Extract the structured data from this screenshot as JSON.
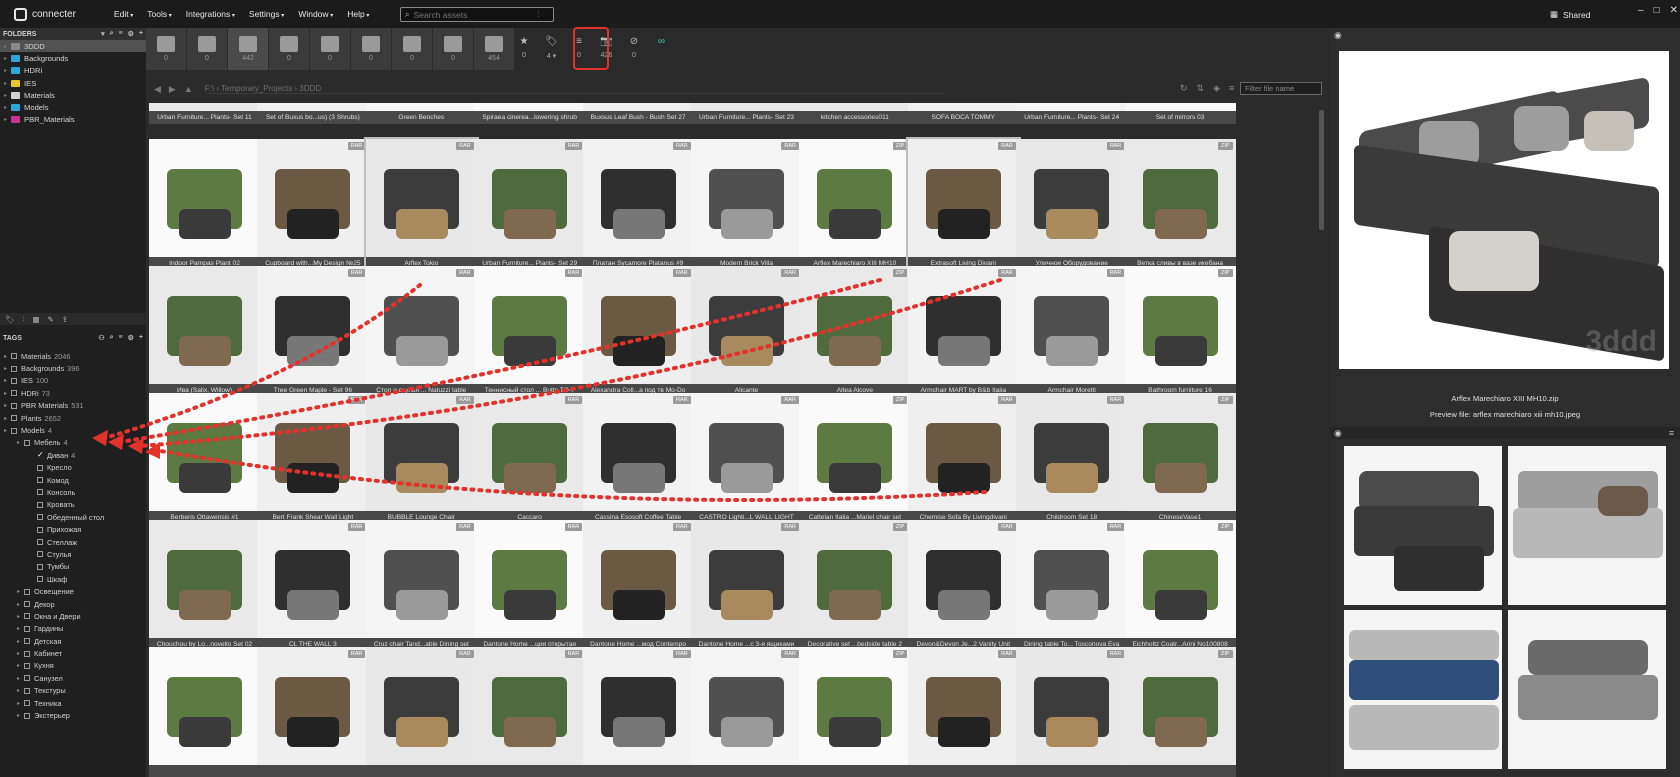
{
  "app": {
    "name": "connecter",
    "shared_label": "Shared"
  },
  "menu": [
    "Edit",
    "Tools",
    "Integrations",
    "Settings",
    "Window",
    "Help"
  ],
  "search": {
    "placeholder": "Search assets"
  },
  "folders_header": "FOLDERS",
  "folders": [
    {
      "label": "3DDD",
      "color": "#8a8a8a",
      "selected": true
    },
    {
      "label": "Backgrounds",
      "color": "#2fa6d8"
    },
    {
      "label": "HDRi",
      "color": "#2fa6d8"
    },
    {
      "label": "IES",
      "color": "#e7c52b"
    },
    {
      "label": "Materials",
      "color": "#d0d0d0"
    },
    {
      "label": "Models",
      "color": "#2fa6d8"
    },
    {
      "label": "PBR_Materials",
      "color": "#c8338e"
    }
  ],
  "tags_header": "TAGS",
  "tags": [
    {
      "label": "Materials",
      "count": "2046"
    },
    {
      "label": "Backgrounds",
      "count": "396"
    },
    {
      "label": "IES",
      "count": "100"
    },
    {
      "label": "HDRi",
      "count": "73"
    },
    {
      "label": "PBR Materials",
      "count": "531"
    },
    {
      "label": "Plants",
      "count": "2652"
    },
    {
      "label": "Models",
      "count": "4"
    },
    {
      "label": "Мебель",
      "count": "4",
      "level": 1
    },
    {
      "label": "Диван",
      "count": "4",
      "level": 2,
      "checked": true
    },
    {
      "label": "Кресло",
      "level": 2
    },
    {
      "label": "Комод",
      "level": 2
    },
    {
      "label": "Консоль",
      "level": 2
    },
    {
      "label": "Кровать",
      "level": 2
    },
    {
      "label": "Обеденный стол",
      "level": 2
    },
    {
      "label": "Прихожая",
      "level": 2
    },
    {
      "label": "Стеллаж",
      "level": 2
    },
    {
      "label": "Стулья",
      "level": 2
    },
    {
      "label": "Тумбы",
      "level": 2
    },
    {
      "label": "Шкаф",
      "level": 2
    },
    {
      "label": "Освещение",
      "level": 1
    },
    {
      "label": "Декор",
      "level": 1
    },
    {
      "label": "Окна и Двери",
      "level": 1
    },
    {
      "label": "Гардины",
      "level": 1
    },
    {
      "label": "Детская",
      "level": 1
    },
    {
      "label": "Кабинет",
      "level": 1
    },
    {
      "label": "Кухня",
      "level": 1
    },
    {
      "label": "Санузел",
      "level": 1
    },
    {
      "label": "Текстуры",
      "level": 1
    },
    {
      "label": "Техника",
      "level": 1
    },
    {
      "label": "Экстерьер",
      "level": 1
    }
  ],
  "toolbar_types": [
    {
      "icon": "cube-icon",
      "count": "0"
    },
    {
      "icon": "sphere-icon",
      "count": "0"
    },
    {
      "icon": "image-icon",
      "count": "442"
    },
    {
      "icon": "video-icon",
      "count": "0"
    },
    {
      "icon": "audio-icon",
      "count": "0"
    },
    {
      "icon": "building-icon",
      "count": "0"
    },
    {
      "icon": "vector-icon",
      "count": "0"
    },
    {
      "icon": "code-icon",
      "count": "0"
    },
    {
      "icon": "document-icon",
      "count": "454"
    }
  ],
  "toolbar_filters": [
    {
      "icon": "star-icon",
      "glyph": "★",
      "count": "0"
    },
    {
      "icon": "tag-icon",
      "glyph": "🏷",
      "count": "4 ▾"
    },
    {
      "icon": "list-icon",
      "glyph": "≡",
      "count": "0"
    },
    {
      "icon": "camera-icon",
      "glyph": "📷",
      "count": "426"
    },
    {
      "icon": "no-preview-icon",
      "glyph": "⊘",
      "count": "0"
    },
    {
      "icon": "link-icon",
      "glyph": "∞",
      "count": ""
    }
  ],
  "path": "F:\\ › Temporary_Projects › 3DDD",
  "filter_placeholder": "Filter file name",
  "grid_rows": [
    [
      "Urban Furniture... Plants- Set 11",
      "Set of Buxus bo...us) (3 Shrubs)",
      "Green Benches",
      "Spiraea cinerea...lowering shrub",
      "Buxsus Leaf Bush - Bush Set 27",
      "Urban Furniture... Plants- Set 23",
      "kitchen accessories011",
      "SOFA BOCA TOMMY",
      "Urban Furniture... Plants- Set 24",
      "Set of mirrors 03"
    ],
    [
      "Indoor Pampas Plant 02",
      "Cupboard with...My Design №25",
      "Arflex Tokio",
      "Urban Furniture... Plants- Set 29",
      "Платан Sycamore Platanus #9",
      "Modern Brick Villa",
      "Arflex Marechiaro XIII MH10",
      "Extrasoft Living Divani",
      "Уличное Оборудование",
      "Ветка сливы в вазе икебана"
    ],
    [
      "Ива (Salix, Willow)",
      "Tree Green Maple - Set 96",
      "Стол и стулья ... Natuzzi table",
      "Теннисный стол ... Butts TO-7",
      "Alexandra Coll...а под тв Mo-Do",
      "Alicante",
      "Altea Alcove",
      "Armchair MART by B&b Italia",
      "Armchair Moretti",
      "Bathroom furniture 16"
    ],
    [
      "Berberis Ottawensis #1",
      "Bert Frank Shear Wall Light",
      "BUBBLE Lounge Chair",
      "Caccaro",
      "Cassina Esosoft Coffee Table",
      "CASTRO Lighti...L WALL LIGHT",
      "Cattelan Italia ...Mariel chair set",
      "Chemise Sofa By Livingdivani",
      "Childroom Set 18",
      "ChineseVase1"
    ],
    [
      "Chouchou by Lo...novello Set 02",
      "CL THE WALL 3",
      "Cruz chair Tand...able Dining set",
      "Dantone Home ...ция открытая",
      "Dantone Home ...мод Contempo",
      "Dantone Home ...с 3-я ящиками",
      "Decorative set ...bedside table 2",
      "Devon&Devon Je...2 Vanity Unit",
      "Dining table To... Tosconova Eva",
      "Eichholtz Coatr...Arini No100808"
    ],
    [
      "",
      "",
      "",
      "",
      "",
      "",
      "",
      "",
      "",
      ""
    ]
  ],
  "preview": {
    "filename": "Arflex Marechiaro XIII MH10.zip",
    "preview_file": "Preview file: arflex marechiaro xiii mh10.jpeg",
    "watermark": "3ddd"
  }
}
